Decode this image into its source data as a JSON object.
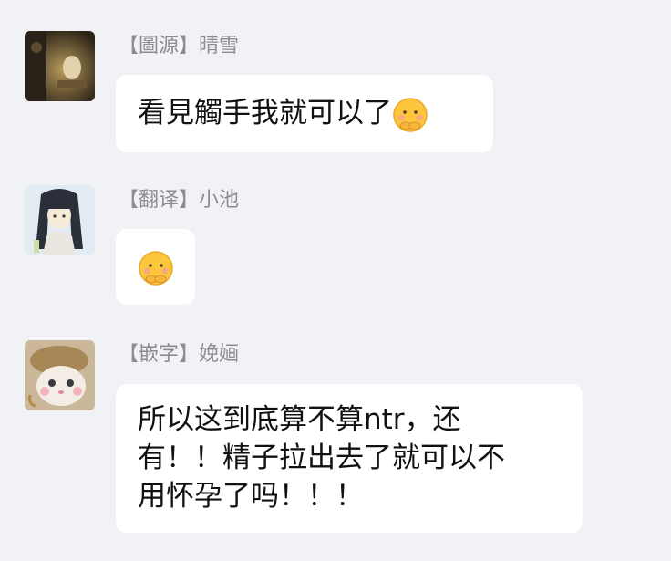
{
  "messages": [
    {
      "sender": "【圖源】晴雪",
      "lines": [
        "看見觸手我就可以了"
      ],
      "emoji": "shy-face-emoji"
    },
    {
      "sender": "【翻译】小池",
      "lines": [],
      "emoji": "shy-face-emoji"
    },
    {
      "sender": "【嵌字】娩婳",
      "lines": [
        "所以这到底算不算ntr，还",
        "有！！精子拉出去了就可以不",
        "用怀孕了吗！！！"
      ]
    }
  ],
  "colors": {
    "background": "#f1f2f6",
    "bubble": "#ffffff",
    "sender_text": "#8c8c92",
    "message_text": "#111111"
  }
}
